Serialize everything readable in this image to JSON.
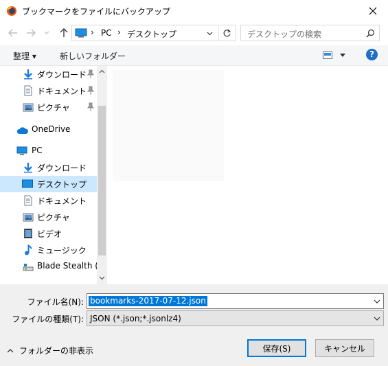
{
  "window": {
    "title": "ブックマークをファイルにバックアップ"
  },
  "address": {
    "path": [
      "PC",
      "デスクトップ"
    ]
  },
  "search": {
    "placeholder": "デスクトップの検索"
  },
  "toolbar": {
    "organize_label": "整理 ▾",
    "new_folder_label": "新しいフォルダー"
  },
  "nav": {
    "items": [
      {
        "label": "ダウンロード",
        "icon": "download-icon",
        "pinned": true
      },
      {
        "label": "ドキュメント",
        "icon": "document-icon",
        "pinned": true
      },
      {
        "label": "ピクチャ",
        "icon": "pictures-icon",
        "pinned": true
      },
      {
        "label": "OneDrive",
        "icon": "onedrive-icon",
        "pinned": false
      },
      {
        "label": "PC",
        "icon": "pc-icon",
        "pinned": false
      },
      {
        "label": "ダウンロード",
        "icon": "download-icon",
        "pinned": false
      },
      {
        "label": "デスクトップ",
        "icon": "desktop-icon",
        "pinned": false,
        "selected": true
      },
      {
        "label": "ドキュメント",
        "icon": "document-icon",
        "pinned": false
      },
      {
        "label": "ピクチャ",
        "icon": "pictures-icon",
        "pinned": false
      },
      {
        "label": "ビデオ",
        "icon": "video-icon",
        "pinned": false
      },
      {
        "label": "ミュージック",
        "icon": "music-icon",
        "pinned": false
      },
      {
        "label": "Blade Stealth (C:",
        "icon": "drive-icon",
        "pinned": false
      }
    ]
  },
  "form": {
    "filename_label": "ファイル名(N):",
    "filename_value": "bookmarks-2017-07-12.json",
    "filetype_label": "ファイルの種類(T):",
    "filetype_value": "JSON (*.json;*.jsonlz4)"
  },
  "footer": {
    "toggle_folders_label": "フォルダーの非表示",
    "save_label": "保存(S)",
    "cancel_label": "キャンセル"
  },
  "colors": {
    "accent": "#0078d7",
    "selection": "#cce8ff",
    "help": "#1e6fc6"
  }
}
